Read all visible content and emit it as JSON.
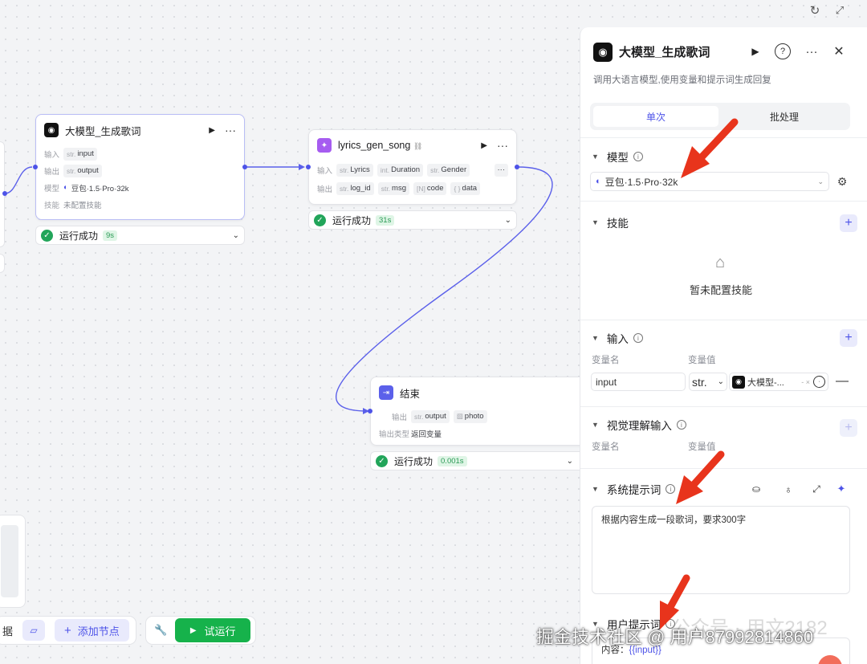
{
  "canvas": {
    "node_llm": {
      "title": "大模型_生成歌词",
      "input_label": "输入",
      "input_type": "str.",
      "input_name": "input",
      "output_label": "输出",
      "output_type": "str.",
      "output_name": "output",
      "model_label": "模型",
      "model_name": "豆包·1.5·Pro·32k",
      "skill_label": "技能",
      "skill_value": "未配置技能",
      "status": "运行成功",
      "time": "9s"
    },
    "node_plugin": {
      "title": "lyrics_gen_song",
      "input_label": "输入",
      "inputs": [
        {
          "type": "str.",
          "name": "Lyrics"
        },
        {
          "type": "int.",
          "name": "Duration"
        },
        {
          "type": "str.",
          "name": "Gender"
        }
      ],
      "output_label": "输出",
      "outputs": [
        {
          "type": "str.",
          "name": "log_id"
        },
        {
          "type": "str.",
          "name": "msg"
        },
        {
          "type": "[N]",
          "name": "code"
        },
        {
          "type": "{ }",
          "name": "data"
        }
      ],
      "status": "运行成功",
      "time": "31s"
    },
    "node_end": {
      "title": "结束",
      "output_label": "输出",
      "outputs": [
        {
          "type": "str.",
          "name": "output"
        },
        {
          "type": "▧",
          "name": "photo"
        }
      ],
      "output_type_label": "输出类型",
      "output_type_value": "返回变量",
      "status": "运行成功",
      "time": "0.001s"
    },
    "toolbar": {
      "left_fragment": "据",
      "add_node": "添加节点",
      "test_run": "试运行"
    }
  },
  "panel": {
    "title": "大模型_生成歌词",
    "description": "调用大语言模型,使用变量和提示词生成回复",
    "tabs": [
      "单次",
      "批处理"
    ],
    "model_section": "模型",
    "model_value": "豆包·1.5·Pro·32k",
    "skill_section": "技能",
    "skill_empty": "暂未配置技能",
    "input_section": "输入",
    "var_name_label": "变量名",
    "var_value_label": "变量值",
    "input_var_name": "input",
    "input_var_type": "str.",
    "input_var_ref": "大模型-...",
    "vision_section": "视觉理解输入",
    "system_prompt_section": "系统提示词",
    "system_prompt": "根据内容生成一段歌词，要求300字",
    "user_prompt_section": "用户提示词",
    "user_prompt_prefix": "内容：",
    "user_prompt_var": "{{input}}"
  },
  "watermark": {
    "faint": "公众号 · 用文2182",
    "main": "掘金技术社区 @ 用户8799281486​0"
  },
  "colors": {
    "accent": "#4d53e8",
    "success": "#22a55a",
    "arrow": "#e8341c"
  }
}
